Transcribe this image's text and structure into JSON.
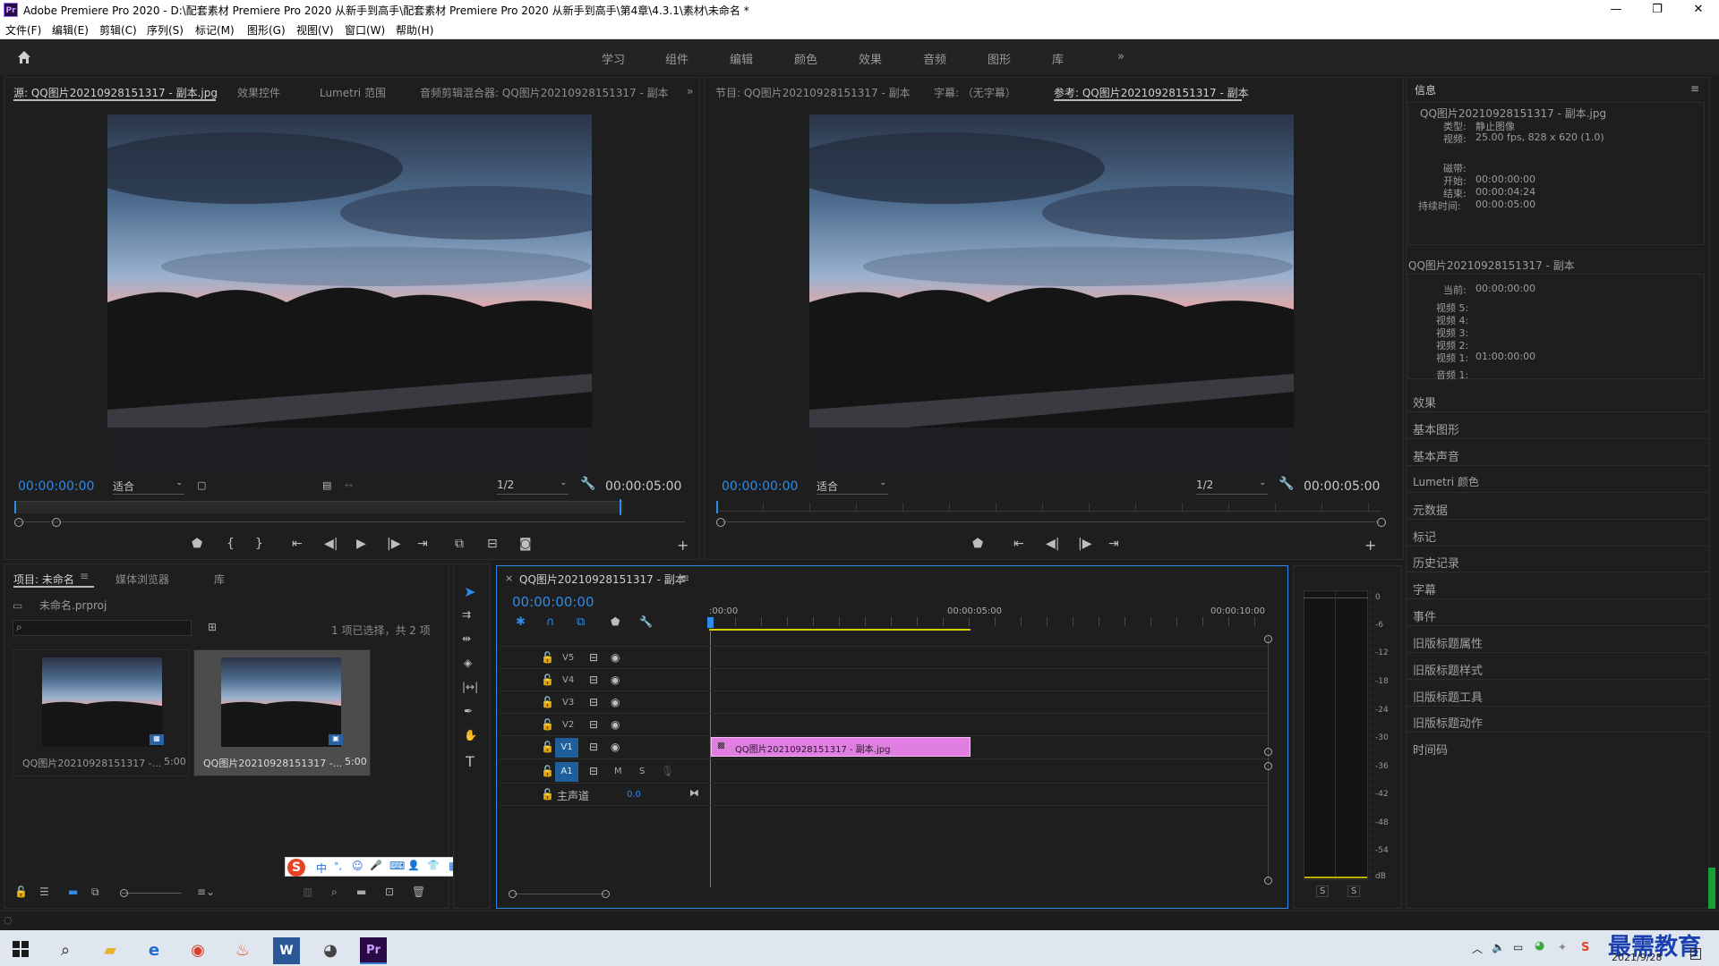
{
  "window": {
    "title": "Adobe Premiere Pro 2020 - D:\\配套素材 Premiere Pro 2020 从新手到高手\\配套素材 Premiere Pro 2020 从新手到高手\\第4章\\4.3.1\\素材\\未命名 *",
    "app_icon": "Pr",
    "min": "—",
    "max": "❐",
    "close": "✕"
  },
  "menu": [
    "文件(F)",
    "编辑(E)",
    "剪辑(C)",
    "序列(S)",
    "标记(M)",
    "图形(G)",
    "视图(V)",
    "窗口(W)",
    "帮助(H)"
  ],
  "workspaces": [
    "学习",
    "组件",
    "编辑",
    "颜色",
    "效果",
    "音频",
    "图形",
    "库",
    "»"
  ],
  "source_panel": {
    "tabs": [
      "源: QQ图片20210928151317 - 副本.jpg",
      "效果控件",
      "Lumetri 范围",
      "音频剪辑混合器: QQ图片20210928151317 - 副本"
    ],
    "timecode": "00:00:00:00",
    "fit": "适合",
    "resolution": "1/2",
    "duration": "00:00:05:00"
  },
  "program_panel": {
    "tabs": [
      "节目: QQ图片20210928151317 - 副本",
      "字幕: （无字幕）",
      "参考: QQ图片20210928151317 - 副本"
    ],
    "timecode": "00:00:00:00",
    "fit": "适合",
    "resolution": "1/2",
    "duration": "00:00:05:00"
  },
  "info_panel": {
    "title": "信息",
    "clip_name": "QQ图片20210928151317 - 副本.jpg",
    "type_label": "类型:",
    "type_value": "静止图像",
    "video_label": "视频:",
    "video_value": "25.00 fps, 828 x 620 (1.0)",
    "tape_label": "磁带:",
    "start_label": "开始:",
    "start_value": "00:00:00:00",
    "end_label": "结束:",
    "end_value": "00:00:04:24",
    "dur_label": "持续时间:",
    "dur_value": "00:00:05:00",
    "seq_name": "QQ图片20210928151317 - 副本",
    "current_label": "当前:",
    "current_value": "00:00:00:00",
    "v5": "视频 5:",
    "v4": "视频 4:",
    "v3": "视频 3:",
    "v2": "视频 2:",
    "v1": "视频 1:",
    "v1_value": "01:00:00:00",
    "a1": "音频 1:"
  },
  "right_panels": [
    "效果",
    "基本图形",
    "基本声音",
    "Lumetri 颜色",
    "元数据",
    "标记",
    "历史记录",
    "字幕",
    "事件",
    "旧版标题属性",
    "旧版标题样式",
    "旧版标题工具",
    "旧版标题动作",
    "时间码"
  ],
  "project_panel": {
    "tabs": [
      "项目: 未命名",
      "媒体浏览器",
      "库"
    ],
    "file": "未命名.prproj",
    "selection": "1 项已选择，共 2 项",
    "items": [
      {
        "name": "QQ图片20210928151317 -...",
        "dur": "5:00"
      },
      {
        "name": "QQ图片20210928151317 -...",
        "dur": "5:00"
      }
    ]
  },
  "timeline": {
    "tab": "QQ图片20210928151317 - 副本",
    "timecode": "00:00:00:00",
    "ruler": [
      ":00:00",
      "00:00:05:00",
      "00:00:10:00"
    ],
    "tracks": [
      "V5",
      "V4",
      "V3",
      "V2",
      "V1"
    ],
    "audio_track": "A1",
    "master": "主声道",
    "master_value": "0.0",
    "m_label": "M",
    "s_label": "S",
    "clip": "QQ图片20210928151317 - 副本.jpg"
  },
  "meter": {
    "scale": [
      "0",
      "-6",
      "-12",
      "-18",
      "-24",
      "-30",
      "-36",
      "-42",
      "-48",
      "-54",
      "dB"
    ],
    "s1": "S",
    "s2": "S"
  },
  "ime": {
    "logo": "S",
    "items": [
      "中",
      "°,",
      "☺",
      "🎤",
      "⌨",
      "👤",
      "👕",
      "▦"
    ]
  },
  "taskbar": {
    "date": "2021/9/28",
    "watermark": "最需教育",
    "notif": "2"
  }
}
